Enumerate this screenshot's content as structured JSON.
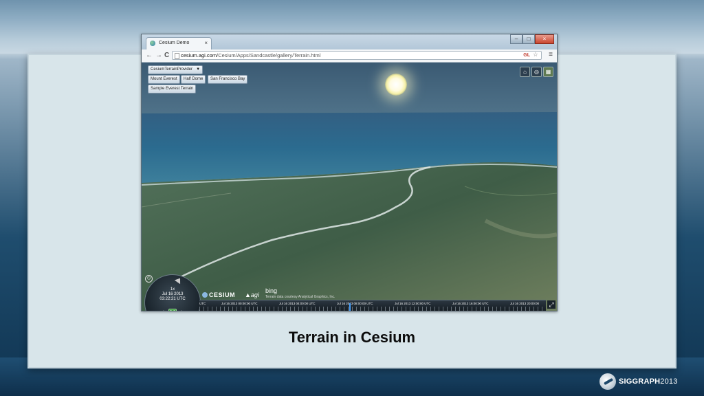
{
  "browser": {
    "tab_title": "Cesium Demo",
    "tab_close": "×",
    "url_domain": "cesium.agi.com",
    "url_path": "/Cesium/Apps/Sandcastle/gallery/Terrain.html",
    "gl_badge": "GL",
    "nav_back": "←",
    "nav_forward": "→",
    "nav_reload": "C",
    "menu_icon": "≡",
    "win_min": "–",
    "win_max": "□",
    "win_close": "×"
  },
  "app": {
    "provider_select": "CesiumTerrainProvider",
    "buttons": [
      "Mount Everest",
      "Half Dome",
      "San Francisco Bay",
      "Sample Everest Terrain"
    ],
    "nav_icons": [
      "home-icon",
      "globe-icon",
      "imagery-icon"
    ],
    "animation": {
      "speed": "1x",
      "date": "Jul 16 2013",
      "time": "03:22:21 UTC"
    },
    "credits": {
      "cesium": "CESIUM",
      "agi": "agi",
      "bing": "bing",
      "text": "Terrain data courtesy Analytical Graphics, Inc."
    },
    "timeline_labels": [
      "UTC",
      "Jul 16 2013 00:00:00 UTC",
      "Jul 16 2013 04:00:00 UTC",
      "Jul 16 2013 08:00:00 UTC",
      "Jul 16 2013 12:00:00 UTC",
      "Jul 16 2013 16:00:00 UTC",
      "Jul 16 2013 20:00:00"
    ]
  },
  "slide": {
    "caption": "Terrain in Cesium",
    "logo_word": "SIGGRAPH",
    "logo_year": "2013"
  }
}
